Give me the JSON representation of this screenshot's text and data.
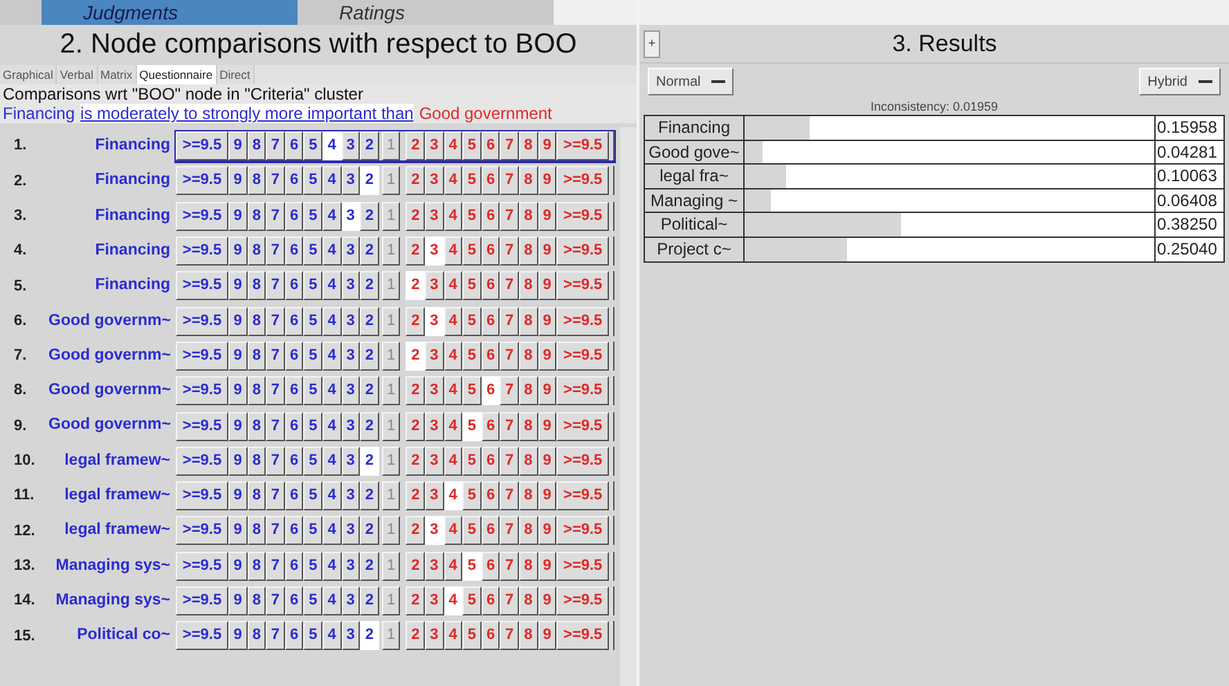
{
  "top_tabs": [
    {
      "label": "Judgments",
      "selected": true
    },
    {
      "label": "Ratings",
      "selected": false
    }
  ],
  "left_title": "2. Node comparisons with respect to BOO",
  "mode_tabs": [
    {
      "label": "Graphical",
      "selected": false
    },
    {
      "label": "Verbal",
      "selected": false
    },
    {
      "label": "Matrix",
      "selected": false
    },
    {
      "label": "Questionnaire",
      "selected": true
    },
    {
      "label": "Direct",
      "selected": false
    }
  ],
  "caption": "Comparisons wrt \"BOO\" node in \"Criteria\" cluster",
  "statement": {
    "left": "Financing",
    "middle": "is moderately to strongly more important than",
    "right": "Good government"
  },
  "rows": [
    {
      "number": "1.",
      "name": "Financing",
      "focused": true,
      "cells": [
        {
          "label": ">=9.5",
          "kind": "left",
          "selected": false
        },
        {
          "label": "9",
          "kind": "left",
          "selected": false
        },
        {
          "label": "8",
          "kind": "left",
          "selected": false
        },
        {
          "label": "7",
          "kind": "left",
          "selected": false
        },
        {
          "label": "6",
          "kind": "left",
          "selected": false
        },
        {
          "label": "5",
          "kind": "left",
          "selected": false
        },
        {
          "label": "4",
          "kind": "left",
          "selected": true
        },
        {
          "label": "3",
          "kind": "left",
          "selected": false
        },
        {
          "label": "2",
          "kind": "left",
          "selected": false
        },
        {
          "label": "1",
          "kind": "middle",
          "selected": false
        },
        {
          "label": "2",
          "kind": "right",
          "selected": false
        },
        {
          "label": "3",
          "kind": "right",
          "selected": false
        },
        {
          "label": "4",
          "kind": "right",
          "selected": false
        },
        {
          "label": "5",
          "kind": "right",
          "selected": false
        },
        {
          "label": "6",
          "kind": "right",
          "selected": false
        },
        {
          "label": "7",
          "kind": "right",
          "selected": false
        },
        {
          "label": "8",
          "kind": "right",
          "selected": false
        },
        {
          "label": "9",
          "kind": "right",
          "selected": false
        },
        {
          "label": ">=9.5",
          "kind": "right",
          "selected": false
        }
      ]
    },
    {
      "number": "2.",
      "name": "Financing",
      "focused": false,
      "cells": [
        {
          "label": ">=9.5",
          "kind": "left",
          "selected": false
        },
        {
          "label": "9",
          "kind": "left",
          "selected": false
        },
        {
          "label": "8",
          "kind": "left",
          "selected": false
        },
        {
          "label": "7",
          "kind": "left",
          "selected": false
        },
        {
          "label": "6",
          "kind": "left",
          "selected": false
        },
        {
          "label": "5",
          "kind": "left",
          "selected": false
        },
        {
          "label": "4",
          "kind": "left",
          "selected": false
        },
        {
          "label": "3",
          "kind": "left",
          "selected": false
        },
        {
          "label": "2",
          "kind": "left",
          "selected": true
        },
        {
          "label": "1",
          "kind": "middle",
          "selected": false
        },
        {
          "label": "2",
          "kind": "right",
          "selected": false
        },
        {
          "label": "3",
          "kind": "right",
          "selected": false
        },
        {
          "label": "4",
          "kind": "right",
          "selected": false
        },
        {
          "label": "5",
          "kind": "right",
          "selected": false
        },
        {
          "label": "6",
          "kind": "right",
          "selected": false
        },
        {
          "label": "7",
          "kind": "right",
          "selected": false
        },
        {
          "label": "8",
          "kind": "right",
          "selected": false
        },
        {
          "label": "9",
          "kind": "right",
          "selected": false
        },
        {
          "label": ">=9.5",
          "kind": "right",
          "selected": false
        }
      ]
    },
    {
      "number": "3.",
      "name": "Financing",
      "focused": false,
      "cells": [
        {
          "label": ">=9.5",
          "kind": "left",
          "selected": false
        },
        {
          "label": "9",
          "kind": "left",
          "selected": false
        },
        {
          "label": "8",
          "kind": "left",
          "selected": false
        },
        {
          "label": "7",
          "kind": "left",
          "selected": false
        },
        {
          "label": "6",
          "kind": "left",
          "selected": false
        },
        {
          "label": "5",
          "kind": "left",
          "selected": false
        },
        {
          "label": "4",
          "kind": "left",
          "selected": false
        },
        {
          "label": "3",
          "kind": "left",
          "selected": true
        },
        {
          "label": "2",
          "kind": "left",
          "selected": false
        },
        {
          "label": "1",
          "kind": "middle",
          "selected": false
        },
        {
          "label": "2",
          "kind": "right",
          "selected": false
        },
        {
          "label": "3",
          "kind": "right",
          "selected": false
        },
        {
          "label": "4",
          "kind": "right",
          "selected": false
        },
        {
          "label": "5",
          "kind": "right",
          "selected": false
        },
        {
          "label": "6",
          "kind": "right",
          "selected": false
        },
        {
          "label": "7",
          "kind": "right",
          "selected": false
        },
        {
          "label": "8",
          "kind": "right",
          "selected": false
        },
        {
          "label": "9",
          "kind": "right",
          "selected": false
        },
        {
          "label": ">=9.5",
          "kind": "right",
          "selected": false
        }
      ]
    },
    {
      "number": "4.",
      "name": "Financing",
      "focused": false,
      "cells": [
        {
          "label": ">=9.5",
          "kind": "left",
          "selected": false
        },
        {
          "label": "9",
          "kind": "left",
          "selected": false
        },
        {
          "label": "8",
          "kind": "left",
          "selected": false
        },
        {
          "label": "7",
          "kind": "left",
          "selected": false
        },
        {
          "label": "6",
          "kind": "left",
          "selected": false
        },
        {
          "label": "5",
          "kind": "left",
          "selected": false
        },
        {
          "label": "4",
          "kind": "left",
          "selected": false
        },
        {
          "label": "3",
          "kind": "left",
          "selected": false
        },
        {
          "label": "2",
          "kind": "left",
          "selected": false
        },
        {
          "label": "1",
          "kind": "middle",
          "selected": false
        },
        {
          "label": "2",
          "kind": "right",
          "selected": false
        },
        {
          "label": "3",
          "kind": "right",
          "selected": true
        },
        {
          "label": "4",
          "kind": "right",
          "selected": false
        },
        {
          "label": "5",
          "kind": "right",
          "selected": false
        },
        {
          "label": "6",
          "kind": "right",
          "selected": false
        },
        {
          "label": "7",
          "kind": "right",
          "selected": false
        },
        {
          "label": "8",
          "kind": "right",
          "selected": false
        },
        {
          "label": "9",
          "kind": "right",
          "selected": false
        },
        {
          "label": ">=9.5",
          "kind": "right",
          "selected": false
        }
      ]
    },
    {
      "number": "5.",
      "name": "Financing",
      "focused": false,
      "cells": [
        {
          "label": ">=9.5",
          "kind": "left",
          "selected": false
        },
        {
          "label": "9",
          "kind": "left",
          "selected": false
        },
        {
          "label": "8",
          "kind": "left",
          "selected": false
        },
        {
          "label": "7",
          "kind": "left",
          "selected": false
        },
        {
          "label": "6",
          "kind": "left",
          "selected": false
        },
        {
          "label": "5",
          "kind": "left",
          "selected": false
        },
        {
          "label": "4",
          "kind": "left",
          "selected": false
        },
        {
          "label": "3",
          "kind": "left",
          "selected": false
        },
        {
          "label": "2",
          "kind": "left",
          "selected": false
        },
        {
          "label": "1",
          "kind": "middle",
          "selected": false
        },
        {
          "label": "2",
          "kind": "right",
          "selected": true
        },
        {
          "label": "3",
          "kind": "right",
          "selected": false
        },
        {
          "label": "4",
          "kind": "right",
          "selected": false
        },
        {
          "label": "5",
          "kind": "right",
          "selected": false
        },
        {
          "label": "6",
          "kind": "right",
          "selected": false
        },
        {
          "label": "7",
          "kind": "right",
          "selected": false
        },
        {
          "label": "8",
          "kind": "right",
          "selected": false
        },
        {
          "label": "9",
          "kind": "right",
          "selected": false
        },
        {
          "label": ">=9.5",
          "kind": "right",
          "selected": false
        }
      ]
    },
    {
      "number": "6.",
      "name": "Good governm~",
      "focused": false,
      "cells": [
        {
          "label": ">=9.5",
          "kind": "left",
          "selected": false
        },
        {
          "label": "9",
          "kind": "left",
          "selected": false
        },
        {
          "label": "8",
          "kind": "left",
          "selected": false
        },
        {
          "label": "7",
          "kind": "left",
          "selected": false
        },
        {
          "label": "6",
          "kind": "left",
          "selected": false
        },
        {
          "label": "5",
          "kind": "left",
          "selected": false
        },
        {
          "label": "4",
          "kind": "left",
          "selected": false
        },
        {
          "label": "3",
          "kind": "left",
          "selected": false
        },
        {
          "label": "2",
          "kind": "left",
          "selected": false
        },
        {
          "label": "1",
          "kind": "middle",
          "selected": false
        },
        {
          "label": "2",
          "kind": "right",
          "selected": false
        },
        {
          "label": "3",
          "kind": "right",
          "selected": true
        },
        {
          "label": "4",
          "kind": "right",
          "selected": false
        },
        {
          "label": "5",
          "kind": "right",
          "selected": false
        },
        {
          "label": "6",
          "kind": "right",
          "selected": false
        },
        {
          "label": "7",
          "kind": "right",
          "selected": false
        },
        {
          "label": "8",
          "kind": "right",
          "selected": false
        },
        {
          "label": "9",
          "kind": "right",
          "selected": false
        },
        {
          "label": ">=9.5",
          "kind": "right",
          "selected": false
        }
      ]
    },
    {
      "number": "7.",
      "name": "Good governm~",
      "focused": false,
      "cells": [
        {
          "label": ">=9.5",
          "kind": "left",
          "selected": false
        },
        {
          "label": "9",
          "kind": "left",
          "selected": false
        },
        {
          "label": "8",
          "kind": "left",
          "selected": false
        },
        {
          "label": "7",
          "kind": "left",
          "selected": false
        },
        {
          "label": "6",
          "kind": "left",
          "selected": false
        },
        {
          "label": "5",
          "kind": "left",
          "selected": false
        },
        {
          "label": "4",
          "kind": "left",
          "selected": false
        },
        {
          "label": "3",
          "kind": "left",
          "selected": false
        },
        {
          "label": "2",
          "kind": "left",
          "selected": false
        },
        {
          "label": "1",
          "kind": "middle",
          "selected": false
        },
        {
          "label": "2",
          "kind": "right",
          "selected": true
        },
        {
          "label": "3",
          "kind": "right",
          "selected": false
        },
        {
          "label": "4",
          "kind": "right",
          "selected": false
        },
        {
          "label": "5",
          "kind": "right",
          "selected": false
        },
        {
          "label": "6",
          "kind": "right",
          "selected": false
        },
        {
          "label": "7",
          "kind": "right",
          "selected": false
        },
        {
          "label": "8",
          "kind": "right",
          "selected": false
        },
        {
          "label": "9",
          "kind": "right",
          "selected": false
        },
        {
          "label": ">=9.5",
          "kind": "right",
          "selected": false
        }
      ]
    },
    {
      "number": "8.",
      "name": "Good governm~",
      "focused": false,
      "cells": [
        {
          "label": ">=9.5",
          "kind": "left",
          "selected": false
        },
        {
          "label": "9",
          "kind": "left",
          "selected": false
        },
        {
          "label": "8",
          "kind": "left",
          "selected": false
        },
        {
          "label": "7",
          "kind": "left",
          "selected": false
        },
        {
          "label": "6",
          "kind": "left",
          "selected": false
        },
        {
          "label": "5",
          "kind": "left",
          "selected": false
        },
        {
          "label": "4",
          "kind": "left",
          "selected": false
        },
        {
          "label": "3",
          "kind": "left",
          "selected": false
        },
        {
          "label": "2",
          "kind": "left",
          "selected": false
        },
        {
          "label": "1",
          "kind": "middle",
          "selected": false
        },
        {
          "label": "2",
          "kind": "right",
          "selected": false
        },
        {
          "label": "3",
          "kind": "right",
          "selected": false
        },
        {
          "label": "4",
          "kind": "right",
          "selected": false
        },
        {
          "label": "5",
          "kind": "right",
          "selected": false
        },
        {
          "label": "6",
          "kind": "right",
          "selected": true
        },
        {
          "label": "7",
          "kind": "right",
          "selected": false
        },
        {
          "label": "8",
          "kind": "right",
          "selected": false
        },
        {
          "label": "9",
          "kind": "right",
          "selected": false
        },
        {
          "label": ">=9.5",
          "kind": "right",
          "selected": false
        }
      ]
    },
    {
      "number": "9.",
      "name": "Good governm~",
      "focused": false,
      "cells": [
        {
          "label": ">=9.5",
          "kind": "left",
          "selected": false
        },
        {
          "label": "9",
          "kind": "left",
          "selected": false
        },
        {
          "label": "8",
          "kind": "left",
          "selected": false
        },
        {
          "label": "7",
          "kind": "left",
          "selected": false
        },
        {
          "label": "6",
          "kind": "left",
          "selected": false
        },
        {
          "label": "5",
          "kind": "left",
          "selected": false
        },
        {
          "label": "4",
          "kind": "left",
          "selected": false
        },
        {
          "label": "3",
          "kind": "left",
          "selected": false
        },
        {
          "label": "2",
          "kind": "left",
          "selected": false
        },
        {
          "label": "1",
          "kind": "middle",
          "selected": false
        },
        {
          "label": "2",
          "kind": "right",
          "selected": false
        },
        {
          "label": "3",
          "kind": "right",
          "selected": false
        },
        {
          "label": "4",
          "kind": "right",
          "selected": false
        },
        {
          "label": "5",
          "kind": "right",
          "selected": true
        },
        {
          "label": "6",
          "kind": "right",
          "selected": false
        },
        {
          "label": "7",
          "kind": "right",
          "selected": false
        },
        {
          "label": "8",
          "kind": "right",
          "selected": false
        },
        {
          "label": "9",
          "kind": "right",
          "selected": false
        },
        {
          "label": ">=9.5",
          "kind": "right",
          "selected": false
        }
      ]
    },
    {
      "number": "10.",
      "name": "legal framew~",
      "focused": false,
      "cells": [
        {
          "label": ">=9.5",
          "kind": "left",
          "selected": false
        },
        {
          "label": "9",
          "kind": "left",
          "selected": false
        },
        {
          "label": "8",
          "kind": "left",
          "selected": false
        },
        {
          "label": "7",
          "kind": "left",
          "selected": false
        },
        {
          "label": "6",
          "kind": "left",
          "selected": false
        },
        {
          "label": "5",
          "kind": "left",
          "selected": false
        },
        {
          "label": "4",
          "kind": "left",
          "selected": false
        },
        {
          "label": "3",
          "kind": "left",
          "selected": false
        },
        {
          "label": "2",
          "kind": "left",
          "selected": true
        },
        {
          "label": "1",
          "kind": "middle",
          "selected": false
        },
        {
          "label": "2",
          "kind": "right",
          "selected": false
        },
        {
          "label": "3",
          "kind": "right",
          "selected": false
        },
        {
          "label": "4",
          "kind": "right",
          "selected": false
        },
        {
          "label": "5",
          "kind": "right",
          "selected": false
        },
        {
          "label": "6",
          "kind": "right",
          "selected": false
        },
        {
          "label": "7",
          "kind": "right",
          "selected": false
        },
        {
          "label": "8",
          "kind": "right",
          "selected": false
        },
        {
          "label": "9",
          "kind": "right",
          "selected": false
        },
        {
          "label": ">=9.5",
          "kind": "right",
          "selected": false
        }
      ]
    },
    {
      "number": "11.",
      "name": "legal framew~",
      "focused": false,
      "cells": [
        {
          "label": ">=9.5",
          "kind": "left",
          "selected": false
        },
        {
          "label": "9",
          "kind": "left",
          "selected": false
        },
        {
          "label": "8",
          "kind": "left",
          "selected": false
        },
        {
          "label": "7",
          "kind": "left",
          "selected": false
        },
        {
          "label": "6",
          "kind": "left",
          "selected": false
        },
        {
          "label": "5",
          "kind": "left",
          "selected": false
        },
        {
          "label": "4",
          "kind": "left",
          "selected": false
        },
        {
          "label": "3",
          "kind": "left",
          "selected": false
        },
        {
          "label": "2",
          "kind": "left",
          "selected": false
        },
        {
          "label": "1",
          "kind": "middle",
          "selected": false
        },
        {
          "label": "2",
          "kind": "right",
          "selected": false
        },
        {
          "label": "3",
          "kind": "right",
          "selected": false
        },
        {
          "label": "4",
          "kind": "right",
          "selected": true
        },
        {
          "label": "5",
          "kind": "right",
          "selected": false
        },
        {
          "label": "6",
          "kind": "right",
          "selected": false
        },
        {
          "label": "7",
          "kind": "right",
          "selected": false
        },
        {
          "label": "8",
          "kind": "right",
          "selected": false
        },
        {
          "label": "9",
          "kind": "right",
          "selected": false
        },
        {
          "label": ">=9.5",
          "kind": "right",
          "selected": false
        }
      ]
    },
    {
      "number": "12.",
      "name": "legal framew~",
      "focused": false,
      "cells": [
        {
          "label": ">=9.5",
          "kind": "left",
          "selected": false
        },
        {
          "label": "9",
          "kind": "left",
          "selected": false
        },
        {
          "label": "8",
          "kind": "left",
          "selected": false
        },
        {
          "label": "7",
          "kind": "left",
          "selected": false
        },
        {
          "label": "6",
          "kind": "left",
          "selected": false
        },
        {
          "label": "5",
          "kind": "left",
          "selected": false
        },
        {
          "label": "4",
          "kind": "left",
          "selected": false
        },
        {
          "label": "3",
          "kind": "left",
          "selected": false
        },
        {
          "label": "2",
          "kind": "left",
          "selected": false
        },
        {
          "label": "1",
          "kind": "middle",
          "selected": false
        },
        {
          "label": "2",
          "kind": "right",
          "selected": false
        },
        {
          "label": "3",
          "kind": "right",
          "selected": true
        },
        {
          "label": "4",
          "kind": "right",
          "selected": false
        },
        {
          "label": "5",
          "kind": "right",
          "selected": false
        },
        {
          "label": "6",
          "kind": "right",
          "selected": false
        },
        {
          "label": "7",
          "kind": "right",
          "selected": false
        },
        {
          "label": "8",
          "kind": "right",
          "selected": false
        },
        {
          "label": "9",
          "kind": "right",
          "selected": false
        },
        {
          "label": ">=9.5",
          "kind": "right",
          "selected": false
        }
      ]
    },
    {
      "number": "13.",
      "name": "Managing sys~",
      "focused": false,
      "cells": [
        {
          "label": ">=9.5",
          "kind": "left",
          "selected": false
        },
        {
          "label": "9",
          "kind": "left",
          "selected": false
        },
        {
          "label": "8",
          "kind": "left",
          "selected": false
        },
        {
          "label": "7",
          "kind": "left",
          "selected": false
        },
        {
          "label": "6",
          "kind": "left",
          "selected": false
        },
        {
          "label": "5",
          "kind": "left",
          "selected": false
        },
        {
          "label": "4",
          "kind": "left",
          "selected": false
        },
        {
          "label": "3",
          "kind": "left",
          "selected": false
        },
        {
          "label": "2",
          "kind": "left",
          "selected": false
        },
        {
          "label": "1",
          "kind": "middle",
          "selected": false
        },
        {
          "label": "2",
          "kind": "right",
          "selected": false
        },
        {
          "label": "3",
          "kind": "right",
          "selected": false
        },
        {
          "label": "4",
          "kind": "right",
          "selected": false
        },
        {
          "label": "5",
          "kind": "right",
          "selected": true
        },
        {
          "label": "6",
          "kind": "right",
          "selected": false
        },
        {
          "label": "7",
          "kind": "right",
          "selected": false
        },
        {
          "label": "8",
          "kind": "right",
          "selected": false
        },
        {
          "label": "9",
          "kind": "right",
          "selected": false
        },
        {
          "label": ">=9.5",
          "kind": "right",
          "selected": false
        }
      ]
    },
    {
      "number": "14.",
      "name": "Managing sys~",
      "focused": false,
      "cells": [
        {
          "label": ">=9.5",
          "kind": "left",
          "selected": false
        },
        {
          "label": "9",
          "kind": "left",
          "selected": false
        },
        {
          "label": "8",
          "kind": "left",
          "selected": false
        },
        {
          "label": "7",
          "kind": "left",
          "selected": false
        },
        {
          "label": "6",
          "kind": "left",
          "selected": false
        },
        {
          "label": "5",
          "kind": "left",
          "selected": false
        },
        {
          "label": "4",
          "kind": "left",
          "selected": false
        },
        {
          "label": "3",
          "kind": "left",
          "selected": false
        },
        {
          "label": "2",
          "kind": "left",
          "selected": false
        },
        {
          "label": "1",
          "kind": "middle",
          "selected": false
        },
        {
          "label": "2",
          "kind": "right",
          "selected": false
        },
        {
          "label": "3",
          "kind": "right",
          "selected": false
        },
        {
          "label": "4",
          "kind": "right",
          "selected": true
        },
        {
          "label": "5",
          "kind": "right",
          "selected": false
        },
        {
          "label": "6",
          "kind": "right",
          "selected": false
        },
        {
          "label": "7",
          "kind": "right",
          "selected": false
        },
        {
          "label": "8",
          "kind": "right",
          "selected": false
        },
        {
          "label": "9",
          "kind": "right",
          "selected": false
        },
        {
          "label": ">=9.5",
          "kind": "right",
          "selected": false
        }
      ]
    },
    {
      "number": "15.",
      "name": "Political co~",
      "focused": false,
      "cells": [
        {
          "label": ">=9.5",
          "kind": "left",
          "selected": false
        },
        {
          "label": "9",
          "kind": "left",
          "selected": false
        },
        {
          "label": "8",
          "kind": "left",
          "selected": false
        },
        {
          "label": "7",
          "kind": "left",
          "selected": false
        },
        {
          "label": "6",
          "kind": "left",
          "selected": false
        },
        {
          "label": "5",
          "kind": "left",
          "selected": false
        },
        {
          "label": "4",
          "kind": "left",
          "selected": false
        },
        {
          "label": "3",
          "kind": "left",
          "selected": false
        },
        {
          "label": "2",
          "kind": "left",
          "selected": true
        },
        {
          "label": "1",
          "kind": "middle",
          "selected": false
        },
        {
          "label": "2",
          "kind": "right",
          "selected": false
        },
        {
          "label": "3",
          "kind": "right",
          "selected": false
        },
        {
          "label": "4",
          "kind": "right",
          "selected": false
        },
        {
          "label": "5",
          "kind": "right",
          "selected": false
        },
        {
          "label": "6",
          "kind": "right",
          "selected": false
        },
        {
          "label": "7",
          "kind": "right",
          "selected": false
        },
        {
          "label": "8",
          "kind": "right",
          "selected": false
        },
        {
          "label": "9",
          "kind": "right",
          "selected": false
        },
        {
          "label": ">=9.5",
          "kind": "right",
          "selected": false
        }
      ]
    }
  ],
  "results": {
    "expand_button": "+",
    "title": "3. Results",
    "left_dropdown": "Normal",
    "right_dropdown": "Hybrid",
    "inconsistency": "Inconsistency: 0.01959",
    "items": [
      {
        "name": "Financing",
        "level": 0.15958,
        "value": "0.15958"
      },
      {
        "name": "Good gove~",
        "level": 0.04281,
        "value": "0.04281"
      },
      {
        "name": "legal fra~",
        "level": 0.10063,
        "value": "0.10063"
      },
      {
        "name": "Managing ~",
        "level": 0.06408,
        "value": "0.06408"
      },
      {
        "name": "Political~",
        "level": 0.3825,
        "value": "0.38250"
      },
      {
        "name": "Project c~",
        "level": 0.2504,
        "value": "0.25040"
      }
    ]
  }
}
